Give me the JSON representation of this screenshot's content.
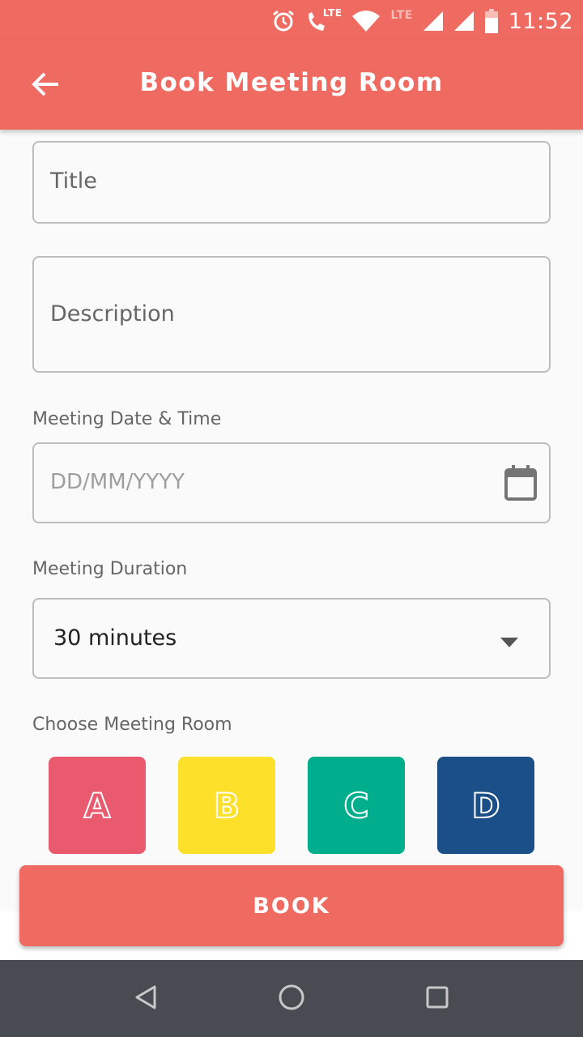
{
  "status_bar": {
    "lte_call_label": "LTE",
    "lte_signal_label": "LTE",
    "time": "11:52",
    "icons": [
      "alarm-icon",
      "lte-call-icon",
      "wifi-icon",
      "signal-icon",
      "signal-icon",
      "battery-icon"
    ]
  },
  "app_bar": {
    "title": "Book Meeting Room",
    "back_icon": "arrow-back-icon",
    "color": "#ef6b61"
  },
  "form": {
    "title_placeholder": "Title",
    "description_placeholder": "Description",
    "date_label": "Meeting Date & Time",
    "date_placeholder": "DD/MM/YYYY",
    "date_icon": "calendar-icon",
    "duration_label": "Meeting Duration",
    "duration_value": "30 minutes",
    "duration_icon": "dropdown-arrow-icon",
    "room_label": "Choose Meeting Room",
    "rooms": [
      {
        "letter": "A",
        "color": "#ea5a6e"
      },
      {
        "letter": "B",
        "color": "#fde02a"
      },
      {
        "letter": "C",
        "color": "#00ae8e"
      },
      {
        "letter": "D",
        "color": "#1b4f88"
      }
    ]
  },
  "book_button": {
    "label": "BOOK",
    "color": "#ef6b61"
  },
  "nav_bar": {
    "icons": [
      "nav-back-icon",
      "nav-home-icon",
      "nav-recents-icon"
    ]
  }
}
